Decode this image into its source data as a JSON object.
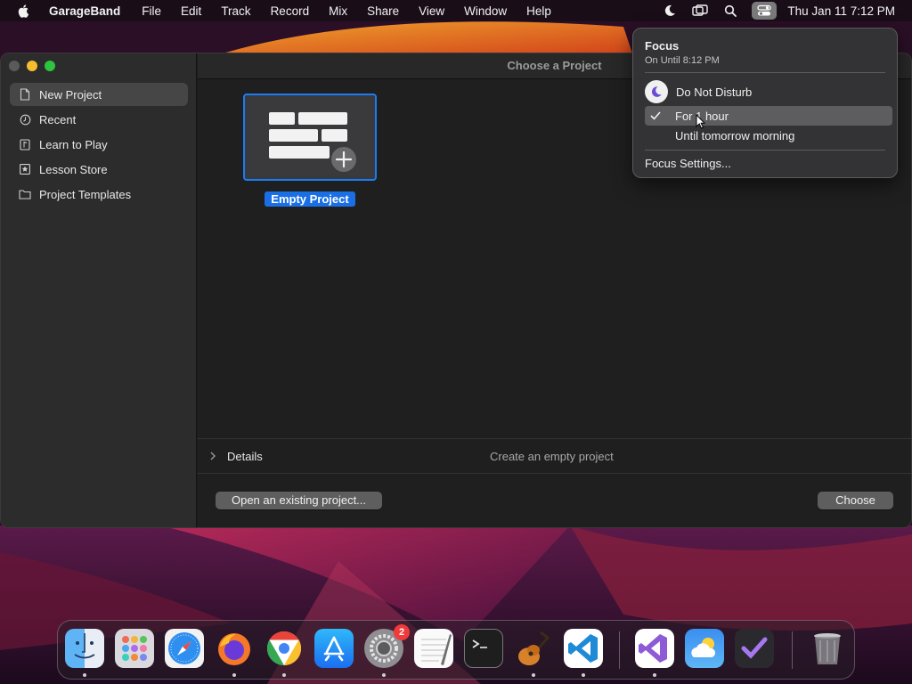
{
  "menubar": {
    "app_name": "GarageBand",
    "menus": [
      "File",
      "Edit",
      "Track",
      "Record",
      "Mix",
      "Share",
      "View",
      "Window",
      "Help"
    ],
    "clock": "Thu Jan 11  7:12 PM"
  },
  "window": {
    "title": "Choose a Project",
    "sidebar": [
      {
        "label": "New Project",
        "icon": "document-icon",
        "selected": true
      },
      {
        "label": "Recent",
        "icon": "clock-icon",
        "selected": false
      },
      {
        "label": "Learn to Play",
        "icon": "music-note-icon",
        "selected": false
      },
      {
        "label": "Lesson Store",
        "icon": "star-icon",
        "selected": false
      },
      {
        "label": "Project Templates",
        "icon": "folder-icon",
        "selected": false
      }
    ],
    "template": {
      "label": "Empty Project"
    },
    "details": {
      "label": "Details",
      "description": "Create an empty project"
    },
    "buttons": {
      "open_existing": "Open an existing project...",
      "choose": "Choose"
    }
  },
  "focus_popover": {
    "title": "Focus",
    "subtitle": "On Until 8:12 PM",
    "mode": "Do Not Disturb",
    "options": [
      {
        "label": "For 1 hour",
        "checked": true
      },
      {
        "label": "Until tomorrow morning",
        "checked": false
      }
    ],
    "settings": "Focus Settings..."
  },
  "dock": {
    "items": [
      {
        "name": "finder",
        "running": true
      },
      {
        "name": "launchpad",
        "running": false
      },
      {
        "name": "safari",
        "running": false
      },
      {
        "name": "firefox",
        "running": true
      },
      {
        "name": "chrome",
        "running": true
      },
      {
        "name": "app-store",
        "running": false
      },
      {
        "name": "system-settings",
        "running": true,
        "badge": "2"
      },
      {
        "name": "textedit",
        "running": false
      },
      {
        "name": "terminal",
        "running": false
      },
      {
        "name": "garageband",
        "running": true
      },
      {
        "name": "vscode",
        "running": true
      },
      {
        "name": "visual-studio",
        "running": true
      },
      {
        "name": "weather",
        "running": false
      },
      {
        "name": "omnifocus",
        "running": false
      },
      {
        "name": "trash",
        "running": false
      }
    ]
  },
  "colors": {
    "accent": "#1a6fe5",
    "selection": "#464646"
  }
}
